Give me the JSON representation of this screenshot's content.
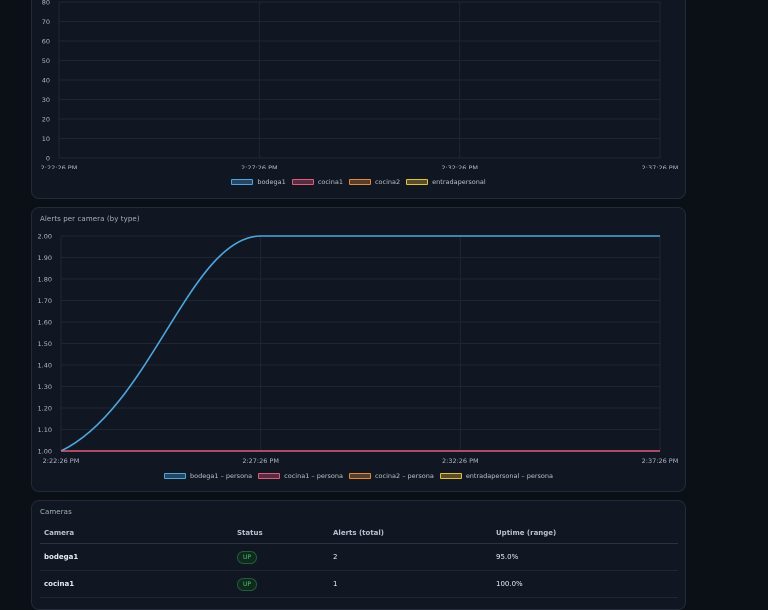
{
  "charts": [
    {
      "title": "",
      "chart_data": {
        "type": "line",
        "x_ticks": [
          "2:22:26 PM",
          "2:27:26 PM",
          "2:32:26 PM",
          "2:37:26 PM"
        ],
        "y_ticks": [
          "0",
          "10",
          "20",
          "30",
          "40",
          "50",
          "60",
          "70",
          "80"
        ],
        "ylim": [
          0,
          80
        ],
        "series": [
          {
            "name": "bodega1",
            "color": "#4ea6e0",
            "values": []
          },
          {
            "name": "cocina1",
            "color": "#e15b7c",
            "values": []
          },
          {
            "name": "cocina2",
            "color": "#e58a3c",
            "values": []
          },
          {
            "name": "entradapersonal",
            "color": "#e8bf3a",
            "values": []
          }
        ]
      }
    },
    {
      "title": "Alerts per camera (by type)",
      "chart_data": {
        "type": "line",
        "x_ticks": [
          "2:22:26 PM",
          "2:27:26 PM",
          "2:32:26 PM",
          "2:37:26 PM"
        ],
        "y_ticks": [
          "1.00",
          "1.10",
          "1.20",
          "1.30",
          "1.40",
          "1.50",
          "1.60",
          "1.70",
          "1.80",
          "1.90",
          "2.00"
        ],
        "ylim": [
          1.0,
          2.0
        ],
        "series": [
          {
            "name": "bodega1 – persona",
            "color": "#4ea6e0",
            "x": [
              "2:22:26 PM",
              "2:27:26 PM",
              "2:37:26 PM"
            ],
            "values": [
              1.0,
              2.0,
              2.0
            ]
          },
          {
            "name": "cocina1 – persona",
            "color": "#e15b7c",
            "x": [
              "2:22:26 PM",
              "2:37:26 PM"
            ],
            "values": [
              1.0,
              1.0
            ]
          },
          {
            "name": "cocina2 – persona",
            "color": "#e58a3c",
            "x": [],
            "values": []
          },
          {
            "name": "entradapersonal – persona",
            "color": "#e8bf3a",
            "x": [],
            "values": []
          }
        ]
      }
    }
  ],
  "cameras": {
    "title": "Cameras",
    "columns": [
      "Camera",
      "Status",
      "Alerts (total)",
      "Uptime (range)"
    ],
    "rows": [
      {
        "camera": "bodega1",
        "status": "UP",
        "alerts": "2",
        "uptime": "95.0%"
      },
      {
        "camera": "cocina1",
        "status": "UP",
        "alerts": "1",
        "uptime": "100.0%"
      }
    ]
  }
}
